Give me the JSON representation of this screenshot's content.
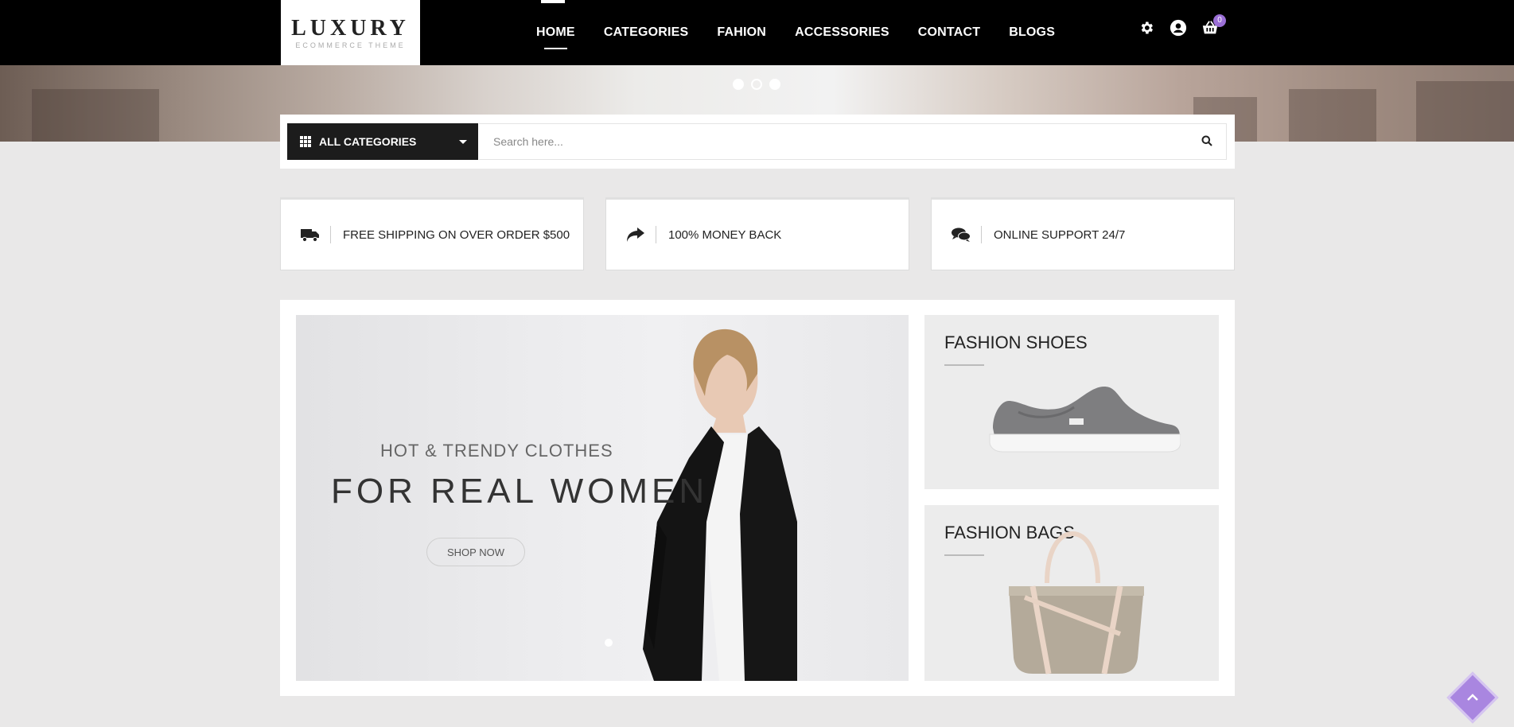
{
  "header": {
    "logo_title": "LUXURY",
    "logo_subtitle": "ECOMMERCE THEME",
    "nav": [
      "HOME",
      "CATEGORIES",
      "FAHION",
      "ACCESSORIES",
      "CONTACT",
      "BLOGS"
    ],
    "active_nav": "HOME",
    "icons": [
      "gear-icon",
      "user-icon",
      "basket-icon"
    ],
    "cart_count": "0"
  },
  "slider": {
    "dots": 3,
    "active_dot": 1
  },
  "search": {
    "category_label": "ALL CATEGORIES",
    "placeholder": "Search here..."
  },
  "features": [
    {
      "icon": "truck-icon",
      "text": "FREE SHIPPING ON OVER ORDER $500"
    },
    {
      "icon": "share-arrow-icon",
      "text": "100% MONEY BACK"
    },
    {
      "icon": "chat-bubbles-icon",
      "text": "ONLINE SUPPORT 24/7"
    }
  ],
  "banner": {
    "kicker": "HOT & TRENDY CLOTHES",
    "title": "FOR REAL WOMEN",
    "cta": "SHOP NOW"
  },
  "side_cards": [
    {
      "title": "FASHION SHOES"
    },
    {
      "title": "FASHION BAGS"
    }
  ],
  "colors": {
    "accent": "#9b6fd6",
    "header_bg": "#000000",
    "page_bg": "#e9e8e8"
  }
}
